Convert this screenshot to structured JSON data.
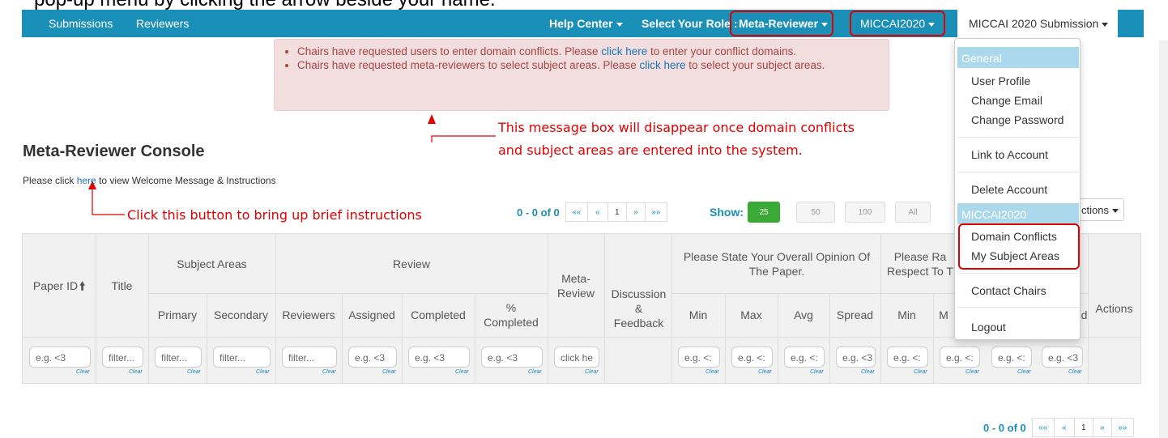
{
  "caption": "pop-up menu by clicking the arrow beside your name.",
  "navbar": {
    "submissions": "Submissions",
    "reviewers": "Reviewers",
    "help_center": "Help Center",
    "select_role_label": "Select Your Role :",
    "role": "Meta-Reviewer",
    "conference": "MICCAI2020",
    "user_menu": "MICCAI 2020 Submission"
  },
  "alert": {
    "item1_pre": "Chairs have requested users to enter domain conflicts. Please ",
    "item1_link": "click here",
    "item1_post": " to enter your conflict domains.",
    "item2_pre": "Chairs have requested meta-reviewers to select subject areas. Please ",
    "item2_link": "click here",
    "item2_post": " to select your subject areas."
  },
  "annotations": {
    "message_box_line1": "This message box will disappear once domain conflicts",
    "message_box_line2": "and subject areas are entered into the system.",
    "instructions": "Click this button to bring up brief instructions"
  },
  "page": {
    "title": "Meta-Reviewer Console",
    "welcome_pre": "Please click ",
    "welcome_link": "here",
    "welcome_post": " to view Welcome Message & Instructions"
  },
  "pager": {
    "count": "0 - 0 of 0",
    "first": "««",
    "prev": "«",
    "page": "1",
    "next": "»",
    "last": "»»"
  },
  "show": {
    "label": "Show:",
    "options": [
      "25",
      "50",
      "100",
      "All"
    ],
    "selected": "25"
  },
  "actions_menu_label": "ctions",
  "table": {
    "headers": {
      "paper_id": "Paper ID",
      "title": "Title",
      "subject_areas": "Subject Areas",
      "primary": "Primary",
      "secondary": "Secondary",
      "review": "Review",
      "reviewers": "Reviewers",
      "assigned": "Assigned",
      "completed": "Completed",
      "pct_completed": "% Completed",
      "meta_review": "Meta-Review",
      "discussion": "Discussion & Feedback",
      "opinion": "Please State Your Overall Opinion Of The Paper.",
      "min": "Min",
      "max": "Max",
      "avg": "Avg",
      "spread": "Spread",
      "rate": "Please Ra Respect To T",
      "m": "M",
      "d": "d",
      "actions": "Actions"
    },
    "filters": {
      "eg": "e.g. <3",
      "eg_clip": "e.g. <:",
      "filter": "filter...",
      "filter_clip": "filter...",
      "click": "click he",
      "clear": "Clear"
    }
  },
  "menu": {
    "general": "General",
    "user_profile": "User Profile",
    "change_email": "Change Email",
    "change_password": "Change Password",
    "link_account": "Link to Account",
    "delete_account": "Delete Account",
    "conference_head": "MICCAI2020",
    "domain_conflicts": "Domain Conflicts",
    "my_subject_areas": "My Subject Areas",
    "contact_chairs": "Contact Chairs",
    "logout": "Logout"
  }
}
